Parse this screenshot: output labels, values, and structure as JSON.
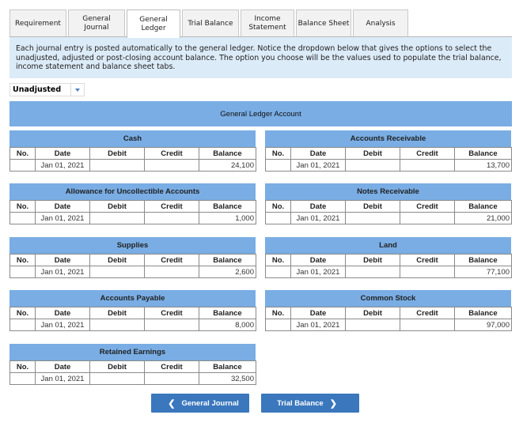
{
  "tabs": [
    {
      "label": "Requirement",
      "active": false
    },
    {
      "label": "General Journal",
      "active": false
    },
    {
      "label": "General Ledger",
      "active": true
    },
    {
      "label": "Trial Balance",
      "active": false
    },
    {
      "label": "Income Statement",
      "active": false
    },
    {
      "label": "Balance Sheet",
      "active": false
    },
    {
      "label": "Analysis",
      "active": false
    }
  ],
  "instructions": "Each journal entry is posted automatically to the general ledger. Notice the dropdown below that gives the options to select the unadjusted, adjusted or post-closing account balance. The option you choose will be the values used to populate the trial balance, income statement and balance sheet tabs.",
  "balance_type": {
    "selected": "Unadjusted"
  },
  "ledger": {
    "header": "General Ledger Account",
    "columns": [
      "No.",
      "Date",
      "Debit",
      "Credit",
      "Balance"
    ],
    "accounts": [
      {
        "name": "Cash",
        "rows": [
          {
            "no": "",
            "date": "Jan 01, 2021",
            "debit": "",
            "credit": "",
            "balance": "24,100"
          }
        ]
      },
      {
        "name": "Accounts Receivable",
        "rows": [
          {
            "no": "",
            "date": "Jan 01, 2021",
            "debit": "",
            "credit": "",
            "balance": "13,700"
          }
        ]
      },
      {
        "name": "Allowance for Uncollectible Accounts",
        "rows": [
          {
            "no": "",
            "date": "Jan 01, 2021",
            "debit": "",
            "credit": "",
            "balance": "1,000"
          }
        ]
      },
      {
        "name": "Notes Receivable",
        "rows": [
          {
            "no": "",
            "date": "Jan 01, 2021",
            "debit": "",
            "credit": "",
            "balance": "21,000"
          }
        ]
      },
      {
        "name": "Supplies",
        "rows": [
          {
            "no": "",
            "date": "Jan 01, 2021",
            "debit": "",
            "credit": "",
            "balance": "2,600"
          }
        ]
      },
      {
        "name": "Land",
        "rows": [
          {
            "no": "",
            "date": "Jan 01, 2021",
            "debit": "",
            "credit": "",
            "balance": "77,100"
          }
        ]
      },
      {
        "name": "Accounts Payable",
        "rows": [
          {
            "no": "",
            "date": "Jan 01, 2021",
            "debit": "",
            "credit": "",
            "balance": "8,000"
          }
        ]
      },
      {
        "name": "Common Stock",
        "rows": [
          {
            "no": "",
            "date": "Jan 01, 2021",
            "debit": "",
            "credit": "",
            "balance": "97,000"
          }
        ]
      },
      {
        "name": "Retained Earnings",
        "rows": [
          {
            "no": "",
            "date": "Jan 01, 2021",
            "debit": "",
            "credit": "",
            "balance": "32,500"
          }
        ]
      }
    ]
  },
  "nav": {
    "prev": {
      "label": "General Journal",
      "icon": "chevron-left-icon"
    },
    "next": {
      "label": "Trial Balance",
      "icon": "chevron-right-icon"
    }
  }
}
